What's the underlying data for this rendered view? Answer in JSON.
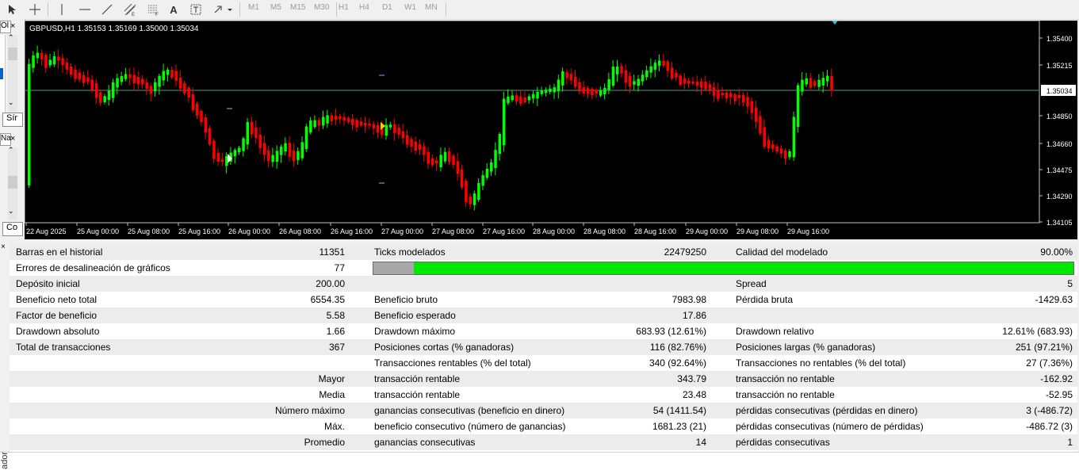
{
  "toolbar": {
    "text_tool_label": "A",
    "timeframes": [
      "M1",
      "M5",
      "M15",
      "M30",
      "H1",
      "H4",
      "D1",
      "W1",
      "MN"
    ]
  },
  "left_panel": {
    "top_tab": "Ol",
    "tab_mid": "Sír",
    "nav_tab": "Na",
    "tab_bottom": "Co",
    "side_caption": "ador"
  },
  "chart": {
    "header": "GBPUSD,H1  1.35153 1.35169 1.35000 1.35034",
    "price_labels": [
      "1.35400",
      "1.35215",
      "1.34850",
      "1.34660",
      "1.34475",
      "1.34290",
      "1.34105"
    ],
    "current_price": "1.35034",
    "time_labels": [
      "22 Aug 2025",
      "25 Aug 00:00",
      "25 Aug 08:00",
      "25 Aug 16:00",
      "26 Aug 00:00",
      "26 Aug 08:00",
      "26 Aug 16:00",
      "27 Aug 00:00",
      "27 Aug 08:00",
      "27 Aug 16:00",
      "28 Aug 00:00",
      "28 Aug 08:00",
      "28 Aug 16:00",
      "29 Aug 00:00",
      "29 Aug 08:00",
      "29 Aug 16:00"
    ],
    "colors": {
      "bull": "#00ff00",
      "bear": "#ff0000",
      "bg": "#000000",
      "price_line": "#5a9a78",
      "axis_text": "#ffffff"
    }
  },
  "report": {
    "col1": [
      {
        "label": "Barras en el historial",
        "value": "11351",
        "label_align": "left"
      },
      {
        "label": "Errores de desalineación de gráficos",
        "value": "77",
        "label_align": "left"
      },
      {
        "label": "Depósito inicial",
        "value": "200.00",
        "label_align": "left"
      },
      {
        "label": "Beneficio neto total",
        "value": "6554.35",
        "label_align": "left"
      },
      {
        "label": "Factor de beneficio",
        "value": "5.58",
        "label_align": "left"
      },
      {
        "label": "Drawdown absoluto",
        "value": "1.66",
        "label_align": "left"
      },
      {
        "label": "Total de transacciones",
        "value": "367",
        "label_align": "left"
      },
      {
        "label": "",
        "value": "",
        "label_align": "left"
      },
      {
        "label": "Mayor",
        "value": "",
        "label_align": "right"
      },
      {
        "label": "Media",
        "value": "",
        "label_align": "right"
      },
      {
        "label": "Número máximo",
        "value": "",
        "label_align": "right"
      },
      {
        "label": "Máx.",
        "value": "",
        "label_align": "right"
      },
      {
        "label": "Promedio",
        "value": "",
        "label_align": "right"
      }
    ],
    "col2": [
      {
        "label": "Ticks modelados",
        "value": "22479250"
      },
      {
        "label": "",
        "value": ""
      },
      {
        "label": "",
        "value": ""
      },
      {
        "label": "Beneficio bruto",
        "value": "7983.98"
      },
      {
        "label": "Beneficio esperado",
        "value": "17.86"
      },
      {
        "label": "Drawdown máximo",
        "value": "683.93 (12.61%)"
      },
      {
        "label": "Posiciones cortas (% ganadoras)",
        "value": "116 (82.76%)"
      },
      {
        "label": "Transacciones rentables (% del total)",
        "value": "340 (92.64%)"
      },
      {
        "label": "transacción rentable",
        "value": "343.79"
      },
      {
        "label": "transacción rentable",
        "value": "23.48"
      },
      {
        "label": "ganancias consecutivas (beneficio en dinero)",
        "value": "54 (1411.54)"
      },
      {
        "label": "beneficio consecutivo (número de ganancias)",
        "value": "1681.23 (21)"
      },
      {
        "label": "ganancias consecutivas",
        "value": "14"
      }
    ],
    "col3": [
      {
        "label": "Calidad del modelado",
        "value": "90.00%"
      },
      {
        "label": "",
        "value": ""
      },
      {
        "label": "Spread",
        "value": "5"
      },
      {
        "label": "Pérdida bruta",
        "value": "-1429.63"
      },
      {
        "label": "",
        "value": ""
      },
      {
        "label": "Drawdown relativo",
        "value": "12.61% (683.93)"
      },
      {
        "label": "Posiciones largas (% ganadoras)",
        "value": "251 (97.21%)"
      },
      {
        "label": "Transacciones no rentables (% del total)",
        "value": "27 (7.36%)"
      },
      {
        "label": "transacción no rentable",
        "value": "-162.92"
      },
      {
        "label": "transacción no rentable",
        "value": "-52.95"
      },
      {
        "label": "pérdidas consecutivas (pérdidas en dinero)",
        "value": "3 (-486.72)"
      },
      {
        "label": "pérdidas consecutivas (número de pérdidas)",
        "value": "-486.72 (3)"
      },
      {
        "label": "pérdidas consecutivas",
        "value": "1"
      }
    ],
    "quality_bar": {
      "gray_fraction": 0.058,
      "gray_color": "#a8a8a8",
      "green_color": "#00e600"
    }
  }
}
